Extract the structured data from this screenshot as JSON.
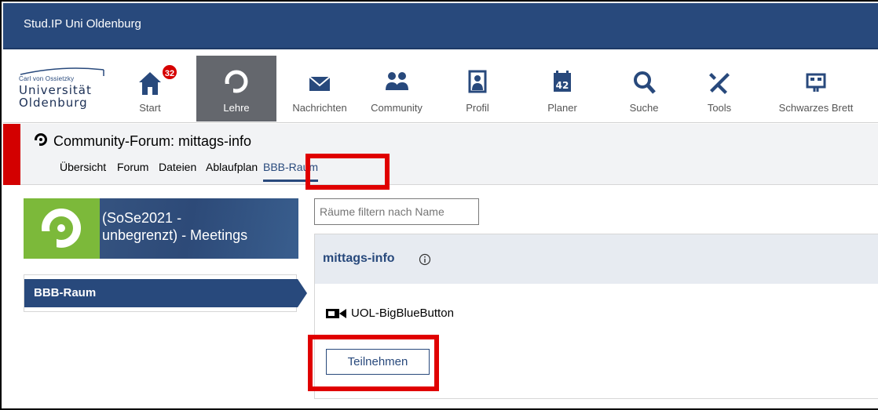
{
  "app": {
    "title": "Stud.IP Uni Oldenburg"
  },
  "logo": {
    "line1": "Carl von Ossietzky",
    "line2": "Universität",
    "line3": "Oldenburg"
  },
  "nav": {
    "items": [
      {
        "label": "Start",
        "icon": "home-icon",
        "badge": "32"
      },
      {
        "label": "Lehre",
        "icon": "studip-logo-icon",
        "active": true
      },
      {
        "label": "Nachrichten",
        "icon": "mail-icon"
      },
      {
        "label": "Community",
        "icon": "community-icon"
      },
      {
        "label": "Profil",
        "icon": "profile-icon"
      },
      {
        "label": "Planer",
        "icon": "calendar-icon",
        "day": "42"
      },
      {
        "label": "Suche",
        "icon": "search-icon"
      },
      {
        "label": "Tools",
        "icon": "tools-icon"
      },
      {
        "label": "Schwarzes Brett",
        "icon": "board-icon"
      }
    ]
  },
  "context": {
    "title": "Community-Forum: mittags-info",
    "tabs": [
      "Übersicht",
      "Forum",
      "Dateien",
      "Ablaufplan",
      "BBB-Raum"
    ],
    "active_tab": "BBB-Raum"
  },
  "sidebar": {
    "banner_line1": "(SoSe2021 -",
    "banner_line2": "unbegrenzt) - Meetings",
    "items": [
      {
        "label": "BBB-Raum"
      }
    ]
  },
  "main": {
    "filter_placeholder": "Räume filtern nach Name",
    "room_group": "mittags-info",
    "room_name": "UOL-BigBlueButton",
    "join_label": "Teilnehmen"
  },
  "colors": {
    "primary": "#28497c",
    "highlight": "#e00000",
    "accent_red": "#d30000",
    "green": "#7cb93a"
  }
}
